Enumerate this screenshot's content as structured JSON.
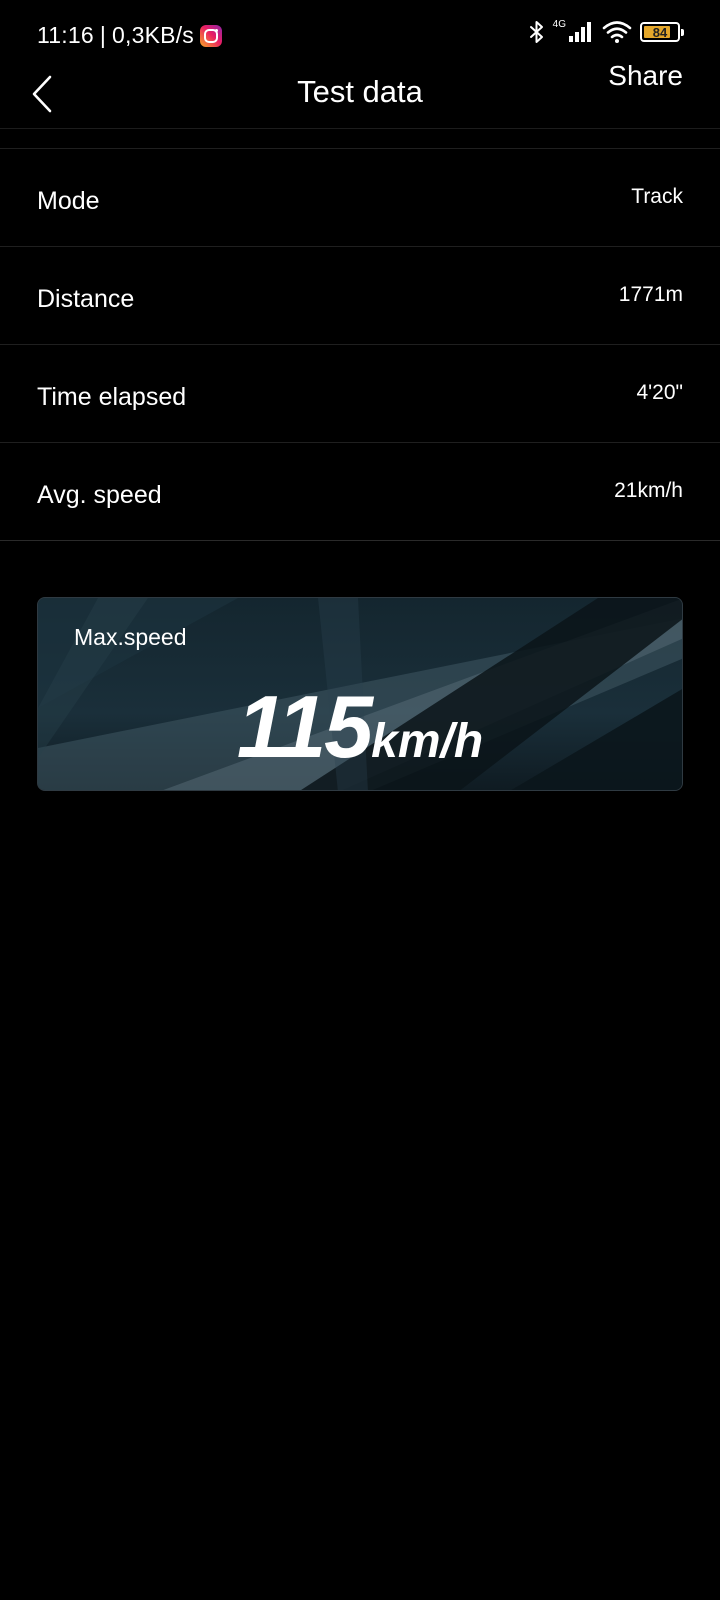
{
  "status_bar": {
    "time": "11:16",
    "separator": "|",
    "net_speed": "0,3KB/s",
    "network_type": "4G",
    "battery_percent": "84",
    "battery_level": 0.84,
    "icons": [
      "instagram-icon",
      "bluetooth-icon",
      "signal-icon",
      "wifi-icon",
      "battery-icon"
    ]
  },
  "header": {
    "title": "Test data",
    "share_label": "Share",
    "back_icon": "chevron-left-icon"
  },
  "rows": [
    {
      "label": "Mode",
      "value": "Track"
    },
    {
      "label": "Distance",
      "value": "1771m"
    },
    {
      "label": "Time elapsed",
      "value": "4'20\""
    },
    {
      "label": "Avg. speed",
      "value": "21km/h"
    }
  ],
  "max_speed": {
    "label": "Max.speed",
    "value": "115",
    "unit": "km/h"
  },
  "colors": {
    "background": "#000000",
    "text": "#ffffff",
    "divider": "#1f1f1f",
    "battery_fill": "#e4a72b",
    "card_base": "#14262f"
  }
}
